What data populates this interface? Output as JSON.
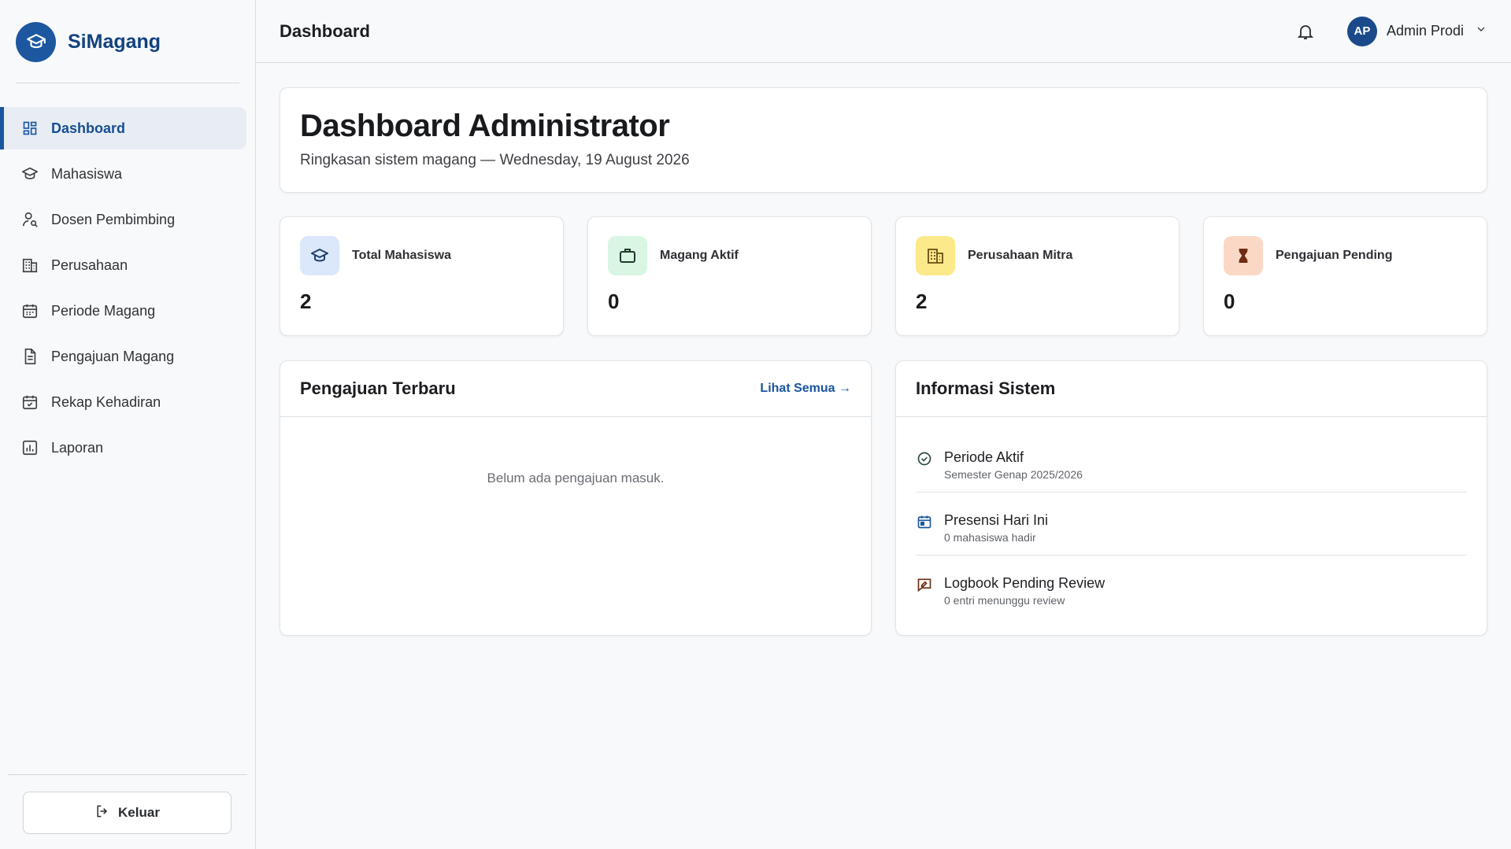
{
  "brand": {
    "name": "SiMagang",
    "logo_icon": "graduation-cap-icon",
    "color": "#1c57a0"
  },
  "sidebar": {
    "items": [
      {
        "label": "Dashboard",
        "icon": "dashboard-grid-icon",
        "active": true
      },
      {
        "label": "Mahasiswa",
        "icon": "graduation-cap-icon",
        "active": false
      },
      {
        "label": "Dosen Pembimbing",
        "icon": "person-search-icon",
        "active": false
      },
      {
        "label": "Perusahaan",
        "icon": "building-icon",
        "active": false
      },
      {
        "label": "Periode Magang",
        "icon": "calendar-icon",
        "active": false
      },
      {
        "label": "Pengajuan Magang",
        "icon": "document-icon",
        "active": false
      },
      {
        "label": "Rekap Kehadiran",
        "icon": "calendar-check-icon",
        "active": false
      },
      {
        "label": "Laporan",
        "icon": "bar-chart-icon",
        "active": false
      }
    ],
    "logout_label": "Keluar"
  },
  "topbar": {
    "title": "Dashboard",
    "user_initials": "AP",
    "user_name": "Admin Prodi"
  },
  "hero": {
    "title": "Dashboard Administrator",
    "subtitle": "Ringkasan sistem magang — Wednesday, 19 August 2026"
  },
  "stats": [
    {
      "label": "Total Mahasiswa",
      "value": "2",
      "icon": "graduation-cap-icon",
      "bg": "#dbe7fb",
      "fg": "#1d3f6e"
    },
    {
      "label": "Magang Aktif",
      "value": "0",
      "icon": "briefcase-icon",
      "bg": "#d9f5e3",
      "fg": "#1f3b2a"
    },
    {
      "label": "Perusahaan Mitra",
      "value": "2",
      "icon": "building-icon",
      "bg": "#fbe98a",
      "fg": "#6a4a10"
    },
    {
      "label": "Pengajuan Pending",
      "value": "0",
      "icon": "hourglass-icon",
      "bg": "#fbd8c6",
      "fg": "#6e2c12"
    }
  ],
  "recent": {
    "title": "Pengajuan Terbaru",
    "link": "Lihat Semua →",
    "empty": "Belum ada pengajuan masuk."
  },
  "info": {
    "title": "Informasi Sistem",
    "items": [
      {
        "title": "Periode Aktif",
        "sub": "Semester Genap 2025/2026",
        "icon": "check-circle-icon"
      },
      {
        "title": "Presensi Hari Ini",
        "sub": "0 mahasiswa hadir",
        "icon": "calendar-today-icon"
      },
      {
        "title": "Logbook Pending Review",
        "sub": "0 entri menunggu review",
        "icon": "chat-edit-icon"
      }
    ]
  }
}
